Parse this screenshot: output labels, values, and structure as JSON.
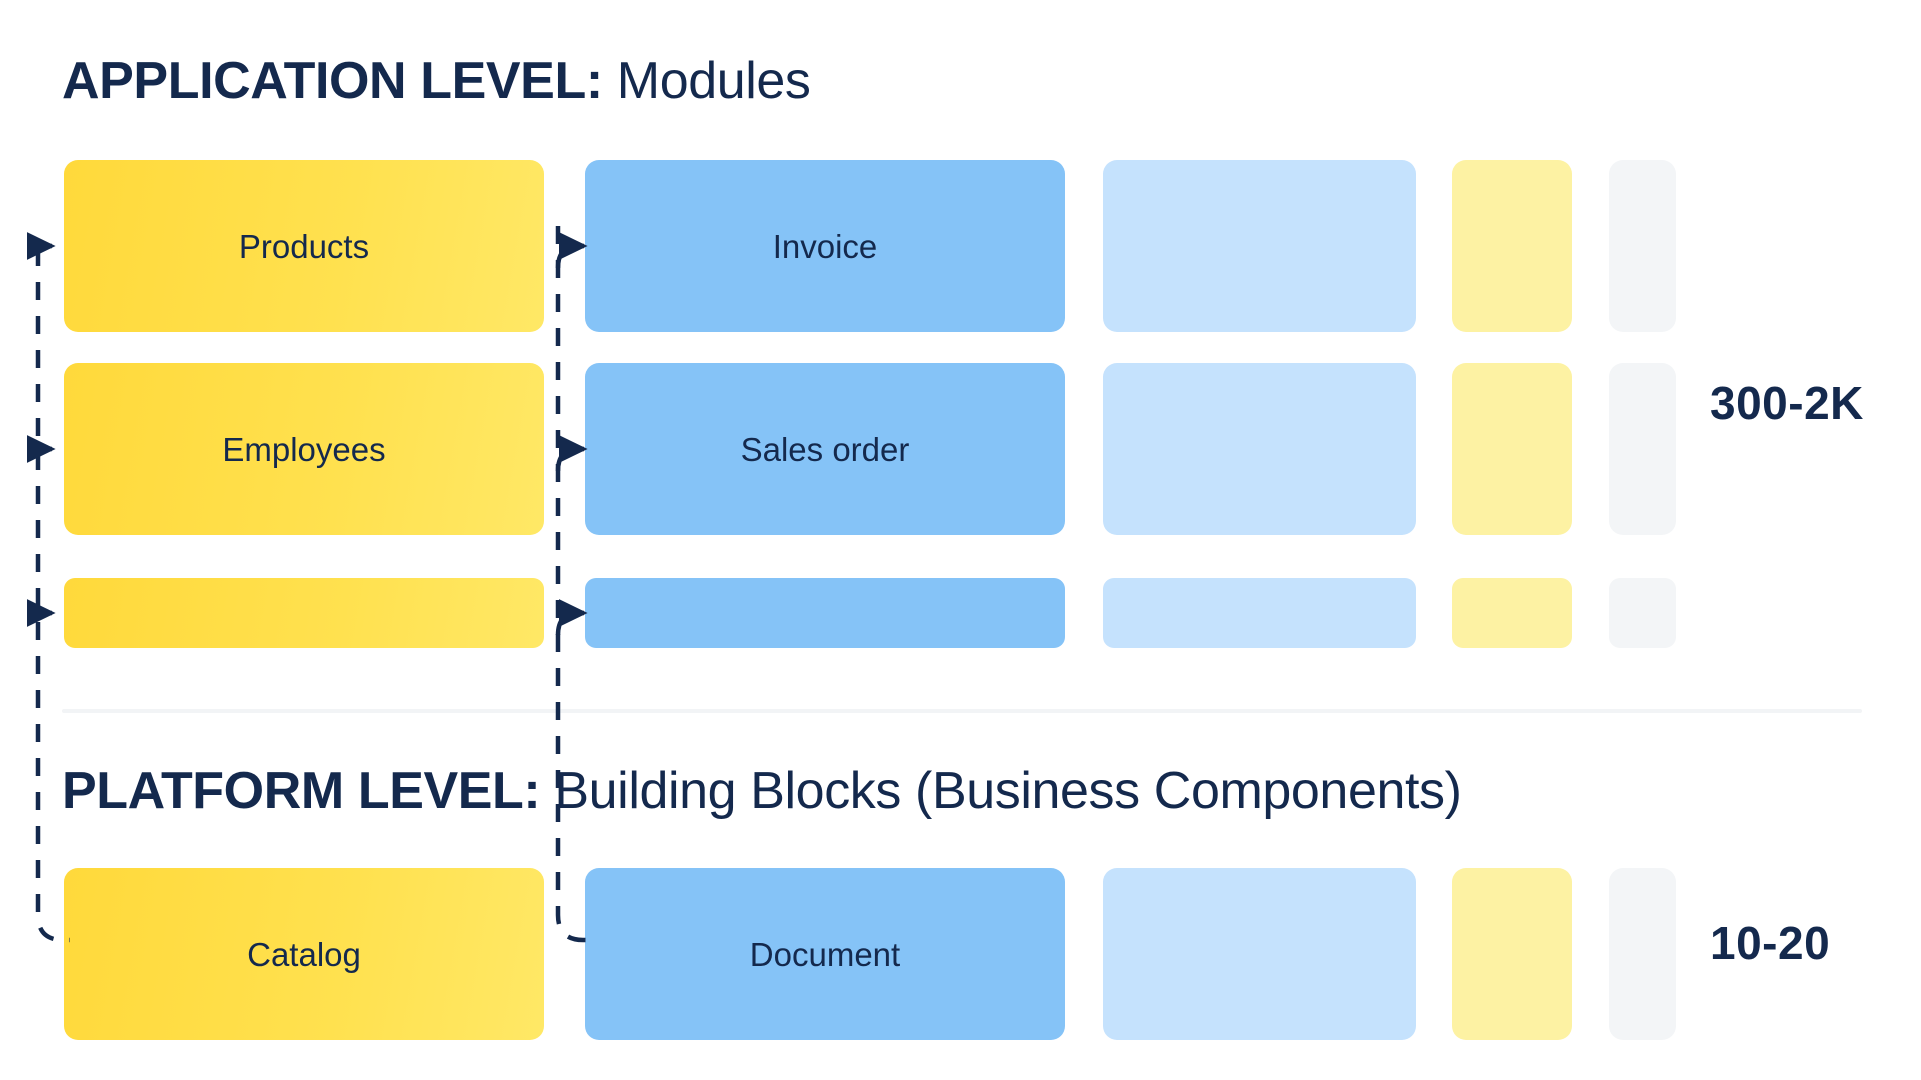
{
  "sections": [
    {
      "id": "application",
      "title_strong": "APPLICATION LEVEL:",
      "title_light": " Modules",
      "count": "300-2K"
    },
    {
      "id": "platform",
      "title_strong": "PLATFORM LEVEL:",
      "title_light": " Building Blocks (Business Components)",
      "count": "10-20"
    }
  ],
  "cards": {
    "r1c1": {
      "label": "Products",
      "color": "#ffd93b"
    },
    "r1c2": {
      "label": "Invoice",
      "color": "#85c3f7"
    },
    "r1c3": {
      "label": "",
      "color": "#c5e2fd"
    },
    "r1c4": {
      "label": "",
      "color": "#fdf2a3"
    },
    "r1c5": {
      "label": "",
      "color": "#f3f5f7"
    },
    "r2c1": {
      "label": "Employees",
      "color": "#ffd93b"
    },
    "r2c2": {
      "label": "Sales order",
      "color": "#85c3f7"
    },
    "r2c3": {
      "label": "",
      "color": "#c5e2fd"
    },
    "r2c4": {
      "label": "",
      "color": "#fdf2a3"
    },
    "r2c5": {
      "label": "",
      "color": "#f3f5f7"
    },
    "r3c1": {
      "label": "",
      "color": "#ffd93b"
    },
    "r3c2": {
      "label": "",
      "color": "#85c3f7"
    },
    "r3c3": {
      "label": "",
      "color": "#c5e2fd"
    },
    "r3c4": {
      "label": "",
      "color": "#fdf2a3"
    },
    "r3c5": {
      "label": "",
      "color": "#f3f5f7"
    },
    "r4c1": {
      "label": "Catalog",
      "color": "#ffd93b"
    },
    "r4c2": {
      "label": "Document",
      "color": "#85c3f7"
    },
    "r4c3": {
      "label": "",
      "color": "#c5e2fd"
    },
    "r4c4": {
      "label": "",
      "color": "#fdf2a3"
    },
    "r4c5": {
      "label": "",
      "color": "#f3f5f7"
    }
  },
  "connectors": {
    "left_trunk_name": "catalog-to-modules-dashed-line",
    "middle_trunk_name": "document-to-modules-dashed-line",
    "style": "dashed",
    "color": "#14294d"
  },
  "palette": {
    "text_navy": "#14294d",
    "yellow": "#ffd93b",
    "blue": "#85c3f7",
    "pale_blue": "#c5e2fd",
    "pale_yellow": "#fdf2a3",
    "grey": "#f3f5f7",
    "divider": "#f2f4f6",
    "background": "#ffffff"
  }
}
